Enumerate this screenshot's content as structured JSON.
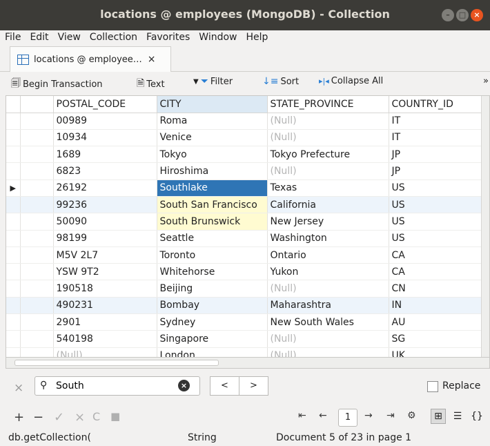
{
  "window": {
    "title": "locations @ employees (MongoDB) - Collection"
  },
  "menu": [
    "File",
    "Edit",
    "View",
    "Collection",
    "Favorites",
    "Window",
    "Help"
  ],
  "tab": {
    "label": "locations @ employee…",
    "close": "×"
  },
  "toolbar": {
    "begin_transaction": "Begin Transaction",
    "text": "Text",
    "filter": "Filter",
    "sort": "Sort",
    "collapse_all": "Collapse All",
    "more": "»"
  },
  "grid": {
    "columns": [
      "POSTAL_CODE",
      "CITY",
      "STATE_PROVINCE",
      "COUNTRY_ID"
    ],
    "rows": [
      [
        "00989",
        "Roma",
        "(Null)",
        "IT"
      ],
      [
        "10934",
        "Venice",
        "(Null)",
        "IT"
      ],
      [
        "1689",
        "Tokyo",
        "Tokyo Prefecture",
        "JP"
      ],
      [
        "6823",
        "Hiroshima",
        "(Null)",
        "JP"
      ],
      [
        "26192",
        "Southlake",
        "Texas",
        "US"
      ],
      [
        "99236",
        "South San Francisco",
        "California",
        "US"
      ],
      [
        "50090",
        "South Brunswick",
        "New Jersey",
        "US"
      ],
      [
        "98199",
        "Seattle",
        "Washington",
        "US"
      ],
      [
        "M5V 2L7",
        "Toronto",
        "Ontario",
        "CA"
      ],
      [
        "YSW 9T2",
        "Whitehorse",
        "Yukon",
        "CA"
      ],
      [
        "190518",
        "Beijing",
        "(Null)",
        "CN"
      ],
      [
        "490231",
        "Bombay",
        "Maharashtra",
        "IN"
      ],
      [
        "2901",
        "Sydney",
        "New South Wales",
        "AU"
      ],
      [
        "540198",
        "Singapore",
        "(Null)",
        "SG"
      ],
      [
        "(Null)",
        "London",
        "(Null)",
        "UK"
      ]
    ],
    "current_row": 4
  },
  "find": {
    "value": "South",
    "prev": "<",
    "next": ">",
    "replace_label": "Replace"
  },
  "pager": {
    "page": "1"
  },
  "status": {
    "left": "db.getCollection(",
    "type": "String",
    "position": "Document 5 of 23 in page 1"
  }
}
